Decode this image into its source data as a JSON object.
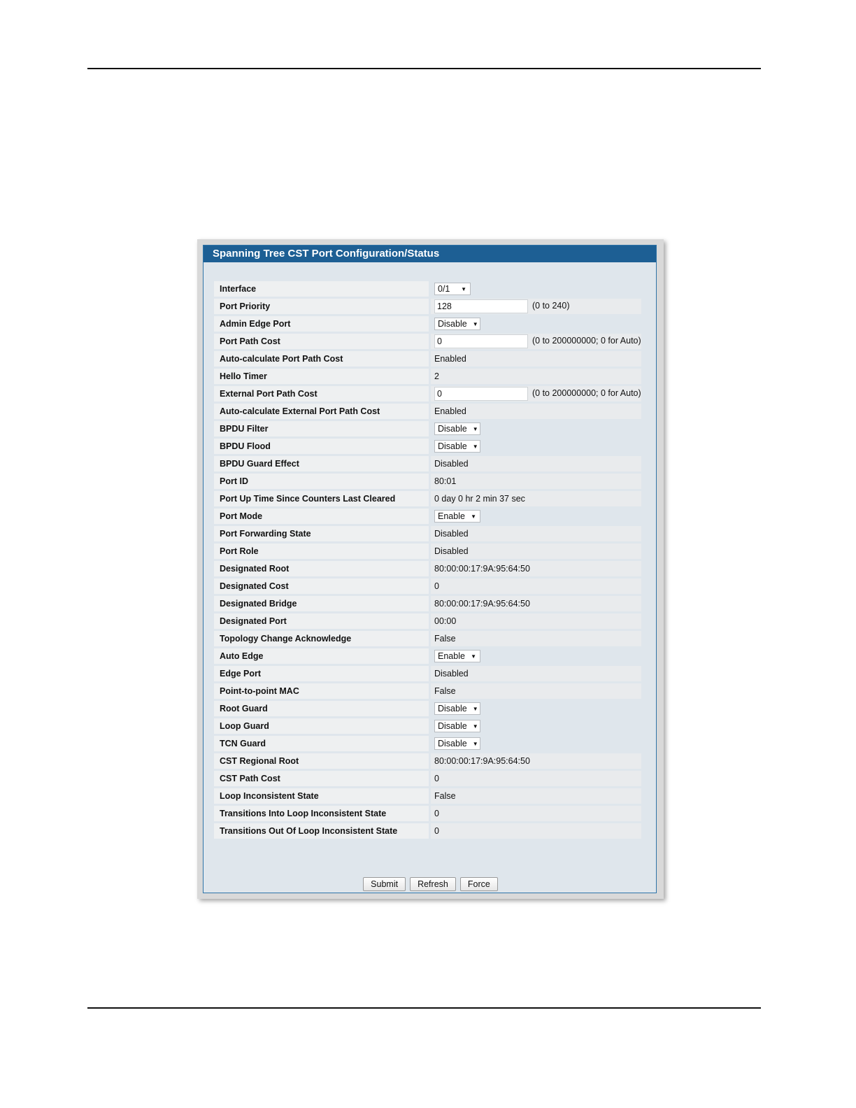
{
  "panel": {
    "title": "Spanning Tree CST Port Configuration/Status"
  },
  "rows": [
    {
      "label": "Interface",
      "type": "select",
      "value": "0/1",
      "bg": false
    },
    {
      "label": "Port Priority",
      "type": "input",
      "value": "128",
      "hint": "(0 to 240)"
    },
    {
      "label": "Admin Edge Port",
      "type": "select",
      "value": "Disable",
      "bg": false
    },
    {
      "label": "Port Path Cost",
      "type": "input",
      "value": "0",
      "hint": "(0 to 200000000; 0 for Auto)"
    },
    {
      "label": "Auto-calculate Port Path Cost",
      "type": "text",
      "value": "Enabled"
    },
    {
      "label": "Hello Timer",
      "type": "text",
      "value": "2"
    },
    {
      "label": "External Port Path Cost",
      "type": "input",
      "value": "0",
      "hint": "(0 to 200000000; 0 for Auto)"
    },
    {
      "label": "Auto-calculate External Port Path Cost",
      "type": "text",
      "value": "Enabled"
    },
    {
      "label": "BPDU Filter",
      "type": "select",
      "value": "Disable",
      "bg": false
    },
    {
      "label": "BPDU Flood",
      "type": "select",
      "value": "Disable",
      "bg": false
    },
    {
      "label": "BPDU Guard Effect",
      "type": "text",
      "value": "Disabled"
    },
    {
      "label": "Port ID",
      "type": "text",
      "value": "80:01"
    },
    {
      "label": "Port Up Time Since Counters Last Cleared",
      "type": "text",
      "value": "0 day 0 hr 2 min 37 sec"
    },
    {
      "label": "Port Mode",
      "type": "select",
      "value": "Enable",
      "bg": false
    },
    {
      "label": "Port Forwarding State",
      "type": "text",
      "value": "Disabled"
    },
    {
      "label": "Port Role",
      "type": "text",
      "value": "Disabled"
    },
    {
      "label": "Designated Root",
      "type": "text",
      "value": "80:00:00:17:9A:95:64:50"
    },
    {
      "label": "Designated Cost",
      "type": "text",
      "value": "0"
    },
    {
      "label": "Designated Bridge",
      "type": "text",
      "value": "80:00:00:17:9A:95:64:50"
    },
    {
      "label": "Designated Port",
      "type": "text",
      "value": "00:00"
    },
    {
      "label": "Topology Change Acknowledge",
      "type": "text",
      "value": "False"
    },
    {
      "label": "Auto Edge",
      "type": "select",
      "value": "Enable",
      "bg": false
    },
    {
      "label": "Edge Port",
      "type": "text",
      "value": "Disabled"
    },
    {
      "label": "Point-to-point MAC",
      "type": "text",
      "value": "False"
    },
    {
      "label": "Root Guard",
      "type": "select",
      "value": "Disable",
      "bg": false
    },
    {
      "label": "Loop Guard",
      "type": "select",
      "value": "Disable",
      "bg": false
    },
    {
      "label": "TCN Guard",
      "type": "select",
      "value": "Disable",
      "bg": false
    },
    {
      "label": "CST Regional Root",
      "type": "text",
      "value": "80:00:00:17:9A:95:64:50"
    },
    {
      "label": "CST Path Cost",
      "type": "text",
      "value": "0"
    },
    {
      "label": "Loop Inconsistent State",
      "type": "text",
      "value": "False"
    },
    {
      "label": "Transitions Into Loop Inconsistent State",
      "type": "text",
      "value": "0"
    },
    {
      "label": "Transitions Out Of Loop Inconsistent State",
      "type": "text",
      "value": "0"
    }
  ],
  "buttons": {
    "submit": "Submit",
    "refresh": "Refresh",
    "force": "Force"
  },
  "icons": {
    "dropdown": "chevron-down-icon"
  }
}
